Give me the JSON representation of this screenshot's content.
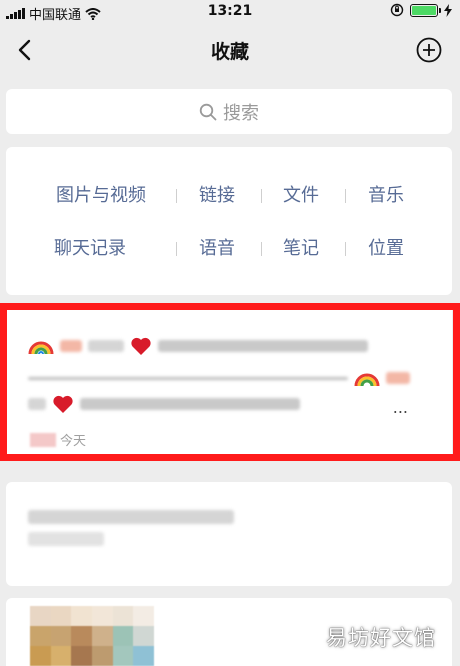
{
  "status_bar": {
    "carrier": "中国联通",
    "time": "13:21"
  },
  "nav": {
    "title": "收藏"
  },
  "search": {
    "placeholder": "搜索"
  },
  "categories": {
    "row1": [
      "图片与视频",
      "链接",
      "文件",
      "音乐"
    ],
    "row2": [
      "聊天记录",
      "语音",
      "笔记",
      "位置"
    ]
  },
  "favorite_item": {
    "ellipsis": "...",
    "date": "今天"
  },
  "watermark": "易坊好文馆",
  "colors": {
    "accent_link": "#576b95",
    "highlight_border": "#ff1b1b",
    "battery_fill": "#4cd964",
    "background": "#ededed"
  },
  "icons": {
    "back": "chevron-left-icon",
    "add": "plus-circle-icon",
    "search": "search-icon"
  }
}
